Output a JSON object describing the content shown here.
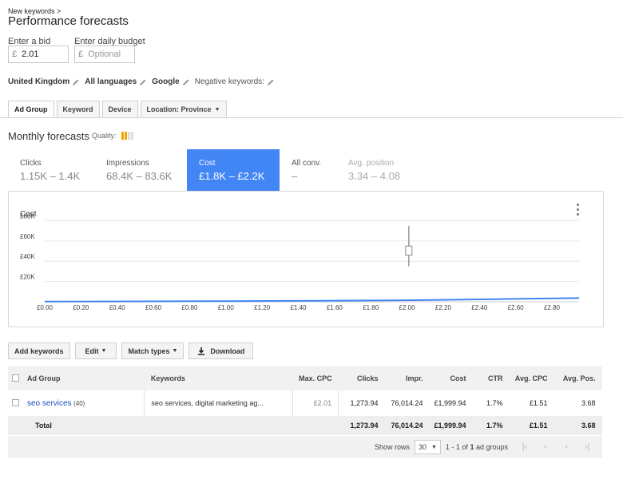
{
  "header": {
    "breadcrumb": "New keywords >",
    "title": "Performance forecasts"
  },
  "bid": {
    "label": "Enter a bid",
    "currency": "£",
    "value": "2.01"
  },
  "budget": {
    "label": "Enter daily budget",
    "currency": "£",
    "placeholder": "Optional"
  },
  "targeting": [
    {
      "label": "United Kingdom",
      "bold": true
    },
    {
      "label": "All languages",
      "bold": true
    },
    {
      "label": "Google",
      "bold": true
    },
    {
      "label": "Negative keywords:",
      "bold": false
    }
  ],
  "tabs": [
    {
      "label": "Ad Group",
      "active": true
    },
    {
      "label": "Keyword",
      "active": false
    },
    {
      "label": "Device",
      "active": false
    },
    {
      "label": "Location: Province",
      "active": false,
      "dropdown": true
    }
  ],
  "forecast": {
    "title": "Monthly forecasts",
    "quality_label": "Quality:"
  },
  "metrics": [
    {
      "label": "Clicks",
      "value": "1.15K – 1.4K"
    },
    {
      "label": "Impressions",
      "value": "68.4K – 83.6K"
    },
    {
      "label": "Cost",
      "value": "£1.8K – £2.2K"
    },
    {
      "label": "All conv.",
      "value": "–"
    },
    {
      "label": "Avg. position",
      "value": "3.34 – 4.08"
    }
  ],
  "chart_data": {
    "type": "line",
    "title": "",
    "ylabel": "Cost",
    "x_ticks": [
      "£0.00",
      "£0.20",
      "£0.40",
      "£0.60",
      "£0.80",
      "£1.00",
      "£1.20",
      "£1.40",
      "£1.60",
      "£1.80",
      "£2.00",
      "£2.20",
      "£2.40",
      "£2.60",
      "£2.80"
    ],
    "y_ticks": [
      "£20K",
      "£40K",
      "£60K",
      "£80K"
    ],
    "xlim": [
      0,
      2.95
    ],
    "ylim": [
      0,
      80000
    ],
    "grid": true,
    "series": [
      {
        "x": [
          0,
          0.5,
          1.0,
          1.5,
          2.0,
          2.5,
          2.95
        ],
        "y": [
          200,
          400,
          600,
          1000,
          1500,
          2600,
          3600
        ]
      }
    ],
    "range_marker": {
      "x": 2.01,
      "low": 35000,
      "high": 75000,
      "box_low": 46000,
      "box_high": 55000
    }
  },
  "toolbar": {
    "add": "Add keywords",
    "edit": "Edit",
    "match": "Match types",
    "download": "Download"
  },
  "table": {
    "columns": [
      "Ad Group",
      "Keywords",
      "Max. CPC",
      "Clicks",
      "Impr.",
      "Cost",
      "CTR",
      "Avg. CPC",
      "Avg. Pos."
    ],
    "row": {
      "name": "seo services",
      "count": "(40)",
      "keywords": "seo services, digital marketing ag...",
      "max_cpc": "£2.01",
      "clicks": "1,273.94",
      "impr": "76,014.24",
      "cost": "£1,999.94",
      "ctr": "1.7%",
      "avg_cpc": "£1.51",
      "avg_pos": "3.68"
    },
    "total": {
      "label": "Total",
      "clicks": "1,273.94",
      "impr": "76,014.24",
      "cost": "£1,999.94",
      "ctr": "1.7%",
      "avg_cpc": "£1.51",
      "avg_pos": "3.68"
    }
  },
  "pager": {
    "show_rows": "Show rows",
    "rows": "30",
    "range_a": "1 - 1 of",
    "range_b": "1",
    "range_c": "ad groups"
  },
  "colors": {
    "accent": "#4285f4",
    "quality_on": "#f4a300",
    "quality_off": "#dddddd"
  }
}
